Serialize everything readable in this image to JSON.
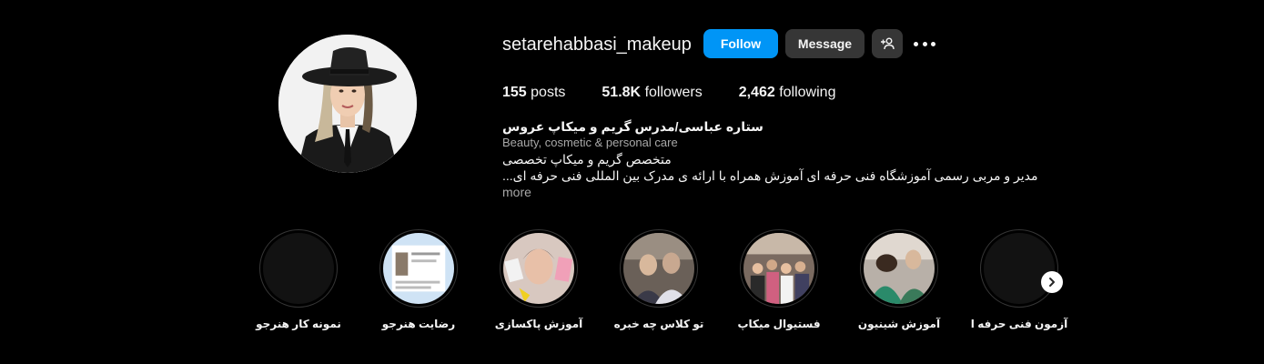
{
  "profile": {
    "username": "setarehabbasi_makeup",
    "follow_label": "Follow",
    "message_label": "Message",
    "posts_count": "155",
    "posts_label": "posts",
    "followers_count": "51.8K",
    "followers_label": "followers",
    "following_count": "2,462",
    "following_label": "following"
  },
  "bio": {
    "name": "ستاره عباسی/مدرس گریم و میکاپ عروس",
    "category": "Beauty, cosmetic & personal care",
    "line1": "متخصص گریم و میکاپ تخصصی",
    "line2": "مدیر و مربی رسمی آموزشگاه فنی حرفه ای آموزش همراه با ارائه ی مدرک بین المللی فنی حرفه ای...",
    "more_label": "more"
  },
  "highlights": [
    {
      "label": "نمونه کار هنرجو"
    },
    {
      "label": "رضایت هنرجو"
    },
    {
      "label": "آموزش پاکسازی"
    },
    {
      "label": "تو کلاس چه خبره"
    },
    {
      "label": "فستیوال میکاپ"
    },
    {
      "label": "آموزش شینیون"
    },
    {
      "label": "آزمون فنی حرفه ا"
    }
  ],
  "icons": {
    "add_user": "add-user-icon",
    "more": "more-options-icon",
    "next": "chevron-right-icon"
  },
  "colors": {
    "background": "#000000",
    "follow_button": "#0095f6",
    "secondary_button": "#363636",
    "muted_text": "#a8a8a8"
  }
}
